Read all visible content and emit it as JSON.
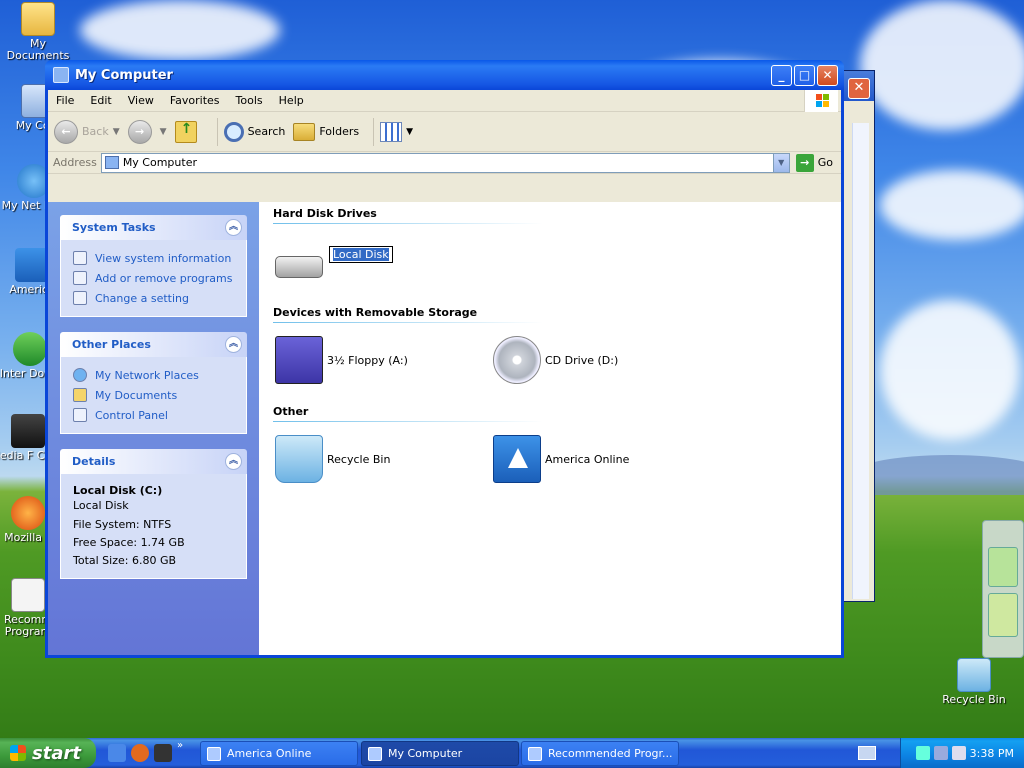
{
  "desktop": {
    "icons": [
      {
        "label": "My Documents"
      },
      {
        "label": "My Com"
      },
      {
        "label": "My Net Plac"
      },
      {
        "label": "America"
      },
      {
        "label": "Inter Down"
      },
      {
        "label": "Media F Class"
      },
      {
        "label": "Mozilla F"
      },
      {
        "label": "Recomm Program"
      },
      {
        "label": "Recycle Bin"
      }
    ]
  },
  "window": {
    "title": "My Computer",
    "menu": [
      "File",
      "Edit",
      "View",
      "Favorites",
      "Tools",
      "Help"
    ],
    "toolbar": {
      "back": "Back",
      "search": "Search",
      "folders": "Folders"
    },
    "address": {
      "label": "Address",
      "value": "My Computer",
      "go": "Go"
    }
  },
  "tasks": {
    "system": {
      "title": "System Tasks",
      "links": [
        "View system information",
        "Add or remove programs",
        "Change a setting"
      ]
    },
    "other": {
      "title": "Other Places",
      "links": [
        "My Network Places",
        "My Documents",
        "Control Panel"
      ]
    },
    "details": {
      "title": "Details",
      "name": "Local Disk (C:)",
      "type": "Local Disk",
      "fs": "File System: NTFS",
      "free": "Free Space: 1.74 GB",
      "total": "Total Size: 6.80 GB"
    }
  },
  "content": {
    "groups": [
      {
        "title": "Hard Disk Drives",
        "items": [
          {
            "label": "Local Disk",
            "icon": "hard-disk-icon"
          }
        ]
      },
      {
        "title": "Devices with Removable Storage",
        "items": [
          {
            "label": "3½ Floppy (A:)",
            "icon": "floppy-drive-icon"
          },
          {
            "label": "CD Drive (D:)",
            "icon": "cd-drive-icon"
          }
        ]
      },
      {
        "title": "Other",
        "items": [
          {
            "label": "Recycle Bin",
            "icon": "recycle-bin-icon"
          },
          {
            "label": "America Online",
            "icon": "aol-icon"
          }
        ]
      }
    ]
  },
  "taskbar": {
    "start": "start",
    "tasks": [
      "America  Online",
      "My Computer",
      "Recommended Progr..."
    ],
    "clock": "3:38 PM"
  },
  "colors": {
    "title_blue": "#0a46d8",
    "link_blue": "#215dc6",
    "task_pane": "#7ba2e7",
    "start_green": "#3c9a3b"
  }
}
